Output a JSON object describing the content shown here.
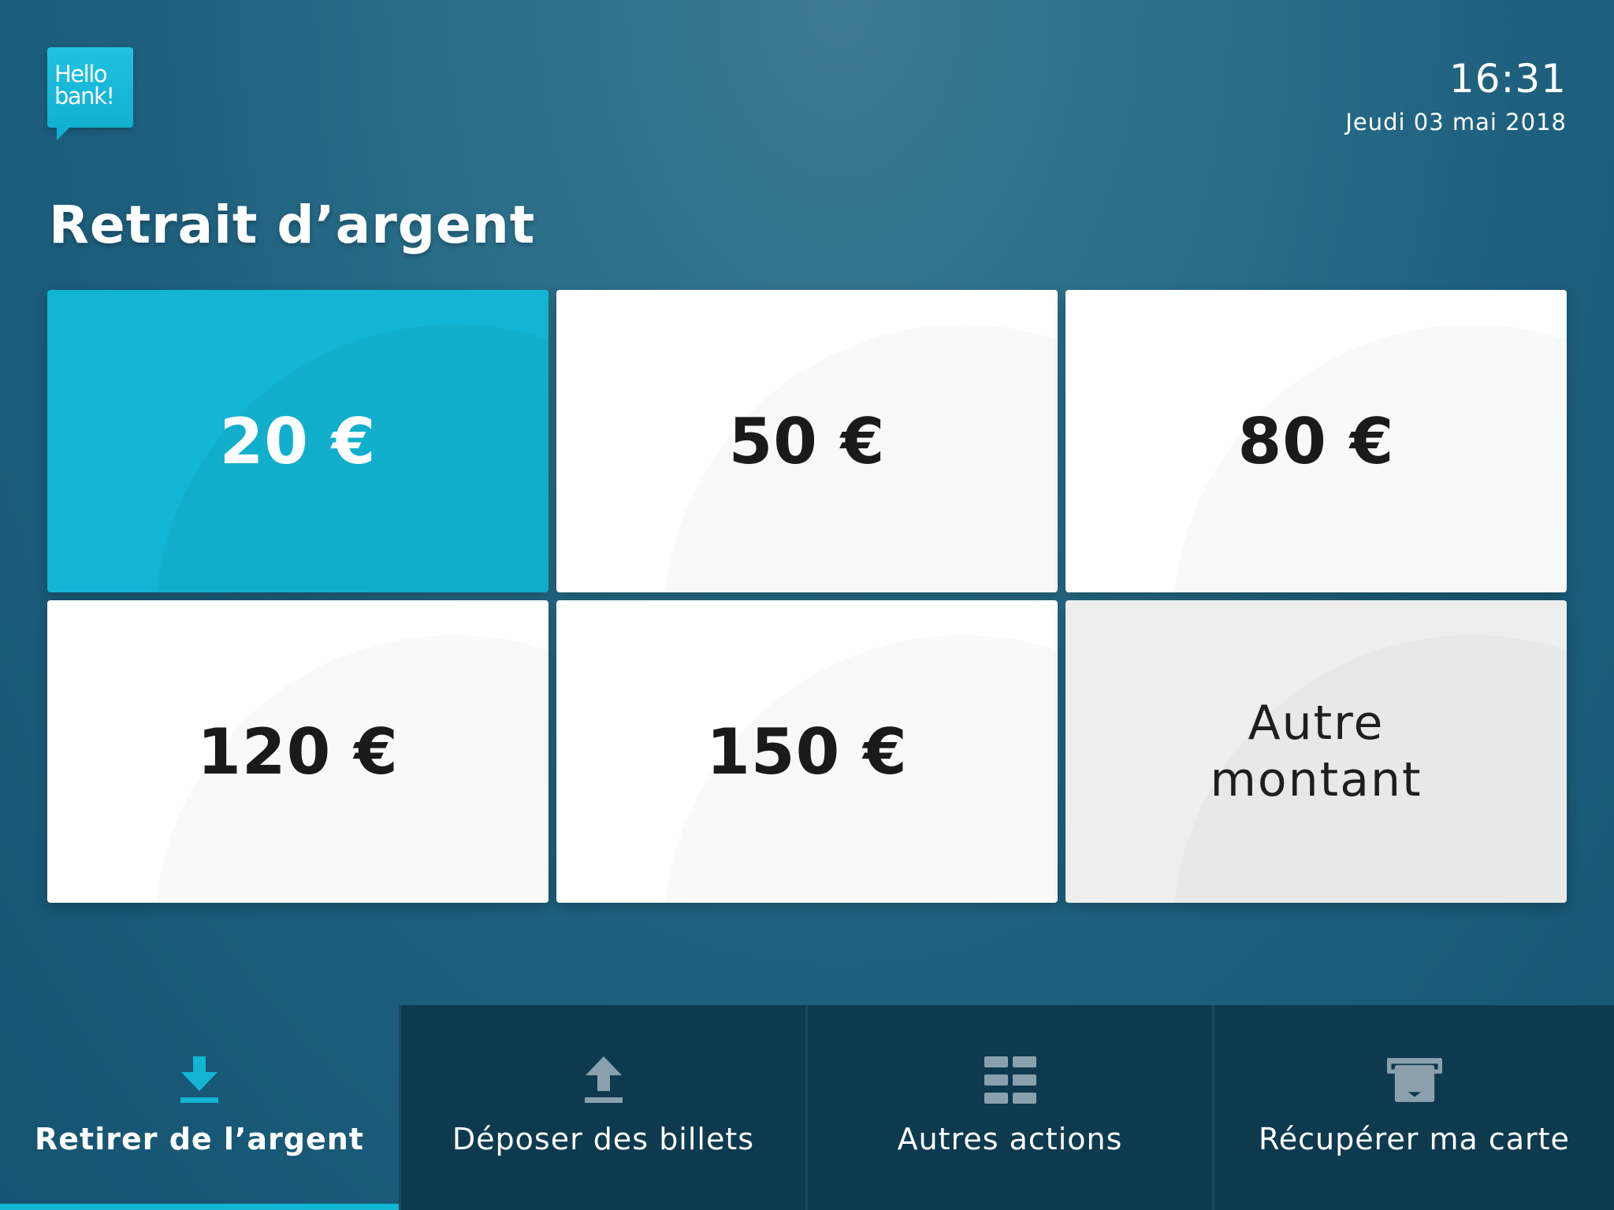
{
  "brand": {
    "logo_line1": "Hello",
    "logo_line2": "bank!",
    "color": "#12b5d3"
  },
  "header": {
    "time": "16:31",
    "date": "Jeudi 03 mai 2018"
  },
  "page": {
    "title": "Retrait d’argent"
  },
  "amounts": {
    "a20": "20 €",
    "a50": "50 €",
    "a80": "80 €",
    "a120": "120 €",
    "a150": "150 €",
    "other_line1": "Autre",
    "other_line2": "montant",
    "selected": "20 €"
  },
  "nav": {
    "withdraw": {
      "label": "Retirer de l’argent",
      "icon": "download-arrow-icon",
      "active": true
    },
    "deposit": {
      "label": "Déposer des billets",
      "icon": "upload-arrow-icon",
      "active": false
    },
    "other": {
      "label": "Autres actions",
      "icon": "grid-icon",
      "active": false
    },
    "card": {
      "label": "Récupérer ma carte",
      "icon": "card-eject-icon",
      "active": false
    }
  }
}
